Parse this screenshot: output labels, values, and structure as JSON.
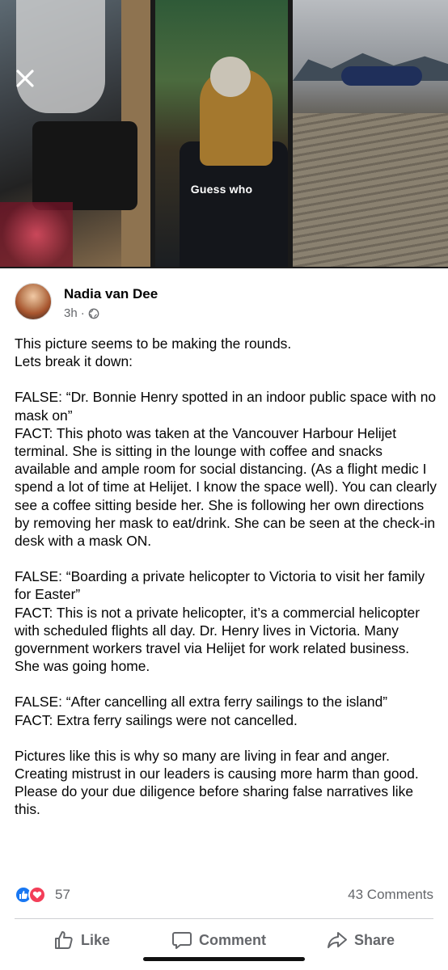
{
  "media": {
    "caption": "Guess who",
    "close_icon": "close-icon"
  },
  "post": {
    "author": "Nadia van Dee",
    "time": "3h",
    "separator": "·",
    "audience_icon": "globe-icon",
    "paragraphs": [
      "This picture seems to be making the rounds.\nLets break it down:",
      "FALSE: “Dr. Bonnie Henry spotted in an indoor public space with no mask on”\nFACT: This photo was taken at the Vancouver Harbour Helijet terminal. She is sitting in the lounge with coffee and snacks available and ample room for social distancing. (As a flight medic I spend a lot of time at Helijet. I know the space well). You can clearly see a coffee sitting beside her. She is following her own directions by removing her mask to eat/drink.  She can be seen at the check-in desk with a mask ON.",
      "FALSE: “Boarding a private helicopter to Victoria to visit her family for Easter”\nFACT: This is not a private helicopter, it’s a commercial helicopter with scheduled flights all day.  Dr. Henry lives in Victoria. Many government workers travel via Helijet for work related business. She was going home.",
      "FALSE: “After cancelling all extra ferry sailings to the island”\nFACT:  Extra ferry sailings were not cancelled.",
      "Pictures like this is why so many are living in fear and anger. Creating mistrust in our leaders is causing more harm than good. Please do your due diligence before sharing false narratives like this."
    ]
  },
  "reactions": {
    "count": "57",
    "comments": "43 Comments",
    "colors": {
      "like": "#1877f2",
      "love": "#f33e58"
    }
  },
  "actions": {
    "like": "Like",
    "comment": "Comment",
    "share": "Share"
  }
}
